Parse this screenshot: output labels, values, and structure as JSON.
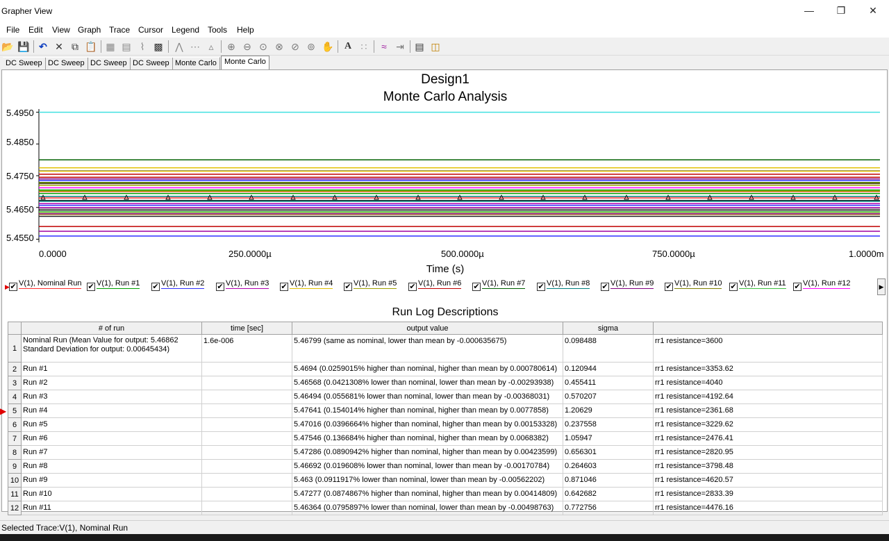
{
  "window": {
    "title": "Grapher View"
  },
  "menu": [
    "File",
    "Edit",
    "View",
    "Graph",
    "Trace",
    "Cursor",
    "Legend",
    "Tools",
    "Help"
  ],
  "toolbar_icons": [
    "open-icon",
    "save-icon",
    "undo-icon",
    "delete-icon",
    "copy-icon",
    "paste-icon",
    "grid-icon",
    "fine-grid-icon",
    "log-axes-icon",
    "reverse-colors-icon",
    "trace-line-icon",
    "trace-points-icon",
    "trace-markers-icon",
    "zoom-in-icon",
    "zoom-out-icon",
    "zoom-fit-icon",
    "zoom-x-icon",
    "zoom-y-icon",
    "zoom-full-icon",
    "pan-icon",
    "text-icon",
    "cursor-icon",
    "overlay-icon",
    "export-icon",
    "properties-icon",
    "print-icon"
  ],
  "tabs": [
    "DC Sweep",
    "DC Sweep",
    "DC Sweep",
    "DC Sweep",
    "Monte Carlo",
    "Monte Carlo"
  ],
  "graph": {
    "title": "Design1",
    "subtitle": "Monte Carlo Analysis",
    "xlabel": "Time (s)",
    "yticks": [
      "5.4950",
      "5.4850",
      "5.4750",
      "5.4650",
      "5.4550"
    ],
    "xticks": [
      "0.0000",
      "250.0000µ",
      "500.0000µ",
      "750.0000µ",
      "1.0000m"
    ]
  },
  "chart_data": {
    "type": "line",
    "xlabel": "Time (s)",
    "ylim": [
      5.454,
      5.496
    ],
    "xlim": [
      0,
      0.001
    ],
    "series": [
      {
        "name": "V(1), Nominal Run",
        "color": "#ff3030",
        "y": 5.46799
      },
      {
        "name": "V(1), Run #1",
        "color": "#00a000",
        "y": 5.4694
      },
      {
        "name": "V(1), Run #2",
        "color": "#3030ff",
        "y": 5.46568
      },
      {
        "name": "V(1), Run #3",
        "color": "#b000b0",
        "y": 5.46494
      },
      {
        "name": "V(1), Run #4",
        "color": "#e0c000",
        "y": 5.47641
      },
      {
        "name": "V(1), Run #5",
        "color": "#a0a000",
        "y": 5.47016
      },
      {
        "name": "V(1), Run #6",
        "color": "#c00000",
        "y": 5.47546
      },
      {
        "name": "V(1), Run #7",
        "color": "#006000",
        "y": 5.47286
      },
      {
        "name": "V(1), Run #8",
        "color": "#008080",
        "y": 5.46692
      },
      {
        "name": "V(1), Run #9",
        "color": "#800080",
        "y": 5.463
      },
      {
        "name": "V(1), Run #10",
        "color": "#808000",
        "y": 5.47277
      },
      {
        "name": "V(1), Run #11",
        "color": "#40c040",
        "y": 5.46364
      },
      {
        "name": "V(1), Run #12",
        "color": "#ff00ff",
        "y": 5.4712
      }
    ]
  },
  "runlog": {
    "title": "Run Log Descriptions",
    "headers": [
      "# of run",
      "time [sec]",
      "output value",
      "sigma",
      ""
    ],
    "rows": [
      {
        "num": "1",
        "run": "Nominal Run (Mean Value for output: 5.46862  Standard Deviation for output: 0.00645434)",
        "time": "1.6e-006",
        "output": "5.46799 (same as nominal, lower than mean by -0.000635675)",
        "sigma": "0.098488",
        "param": "rr1 resistance=3600"
      },
      {
        "num": "2",
        "run": "Run #1",
        "time": "",
        "output": "5.4694 (0.0259015% higher than nominal, higher than mean by 0.000780614)",
        "sigma": "0.120944",
        "param": "rr1 resistance=3353.62"
      },
      {
        "num": "3",
        "run": "Run #2",
        "time": "",
        "output": "5.46568 (0.0421308% lower than nominal, lower than mean by -0.00293938)",
        "sigma": "0.455411",
        "param": "rr1 resistance=4040"
      },
      {
        "num": "4",
        "run": "Run #3",
        "time": "",
        "output": "5.46494 (0.055681% lower than nominal, lower than mean by -0.00368031)",
        "sigma": "0.570207",
        "param": "rr1 resistance=4192.64"
      },
      {
        "num": "5",
        "run": "Run #4",
        "time": "",
        "output": "5.47641 (0.154014% higher than nominal, higher than mean by 0.0077858)",
        "sigma": "1.20629",
        "param": "rr1 resistance=2361.68"
      },
      {
        "num": "6",
        "run": "Run #5",
        "time": "",
        "output": "5.47016 (0.0396664% higher than nominal, higher than mean by 0.00153328)",
        "sigma": "0.237558",
        "param": "rr1 resistance=3229.62"
      },
      {
        "num": "7",
        "run": "Run #6",
        "time": "",
        "output": "5.47546 (0.136684% higher than nominal, higher than mean by 0.0068382)",
        "sigma": "1.05947",
        "param": "rr1 resistance=2476.41"
      },
      {
        "num": "8",
        "run": "Run #7",
        "time": "",
        "output": "5.47286 (0.0890942% higher than nominal, higher than mean by 0.00423599)",
        "sigma": "0.656301",
        "param": "rr1 resistance=2820.95"
      },
      {
        "num": "9",
        "run": "Run #8",
        "time": "",
        "output": "5.46692 (0.019608% lower than nominal, lower than mean by -0.00170784)",
        "sigma": "0.264603",
        "param": "rr1 resistance=3798.48"
      },
      {
        "num": "10",
        "run": "Run #9",
        "time": "",
        "output": "5.463 (0.0911917% lower than nominal, lower than mean by -0.00562202)",
        "sigma": "0.871046",
        "param": "rr1 resistance=4620.57"
      },
      {
        "num": "11",
        "run": "Run #10",
        "time": "",
        "output": "5.47277 (0.0874867% higher than nominal, higher than mean by 0.00414809)",
        "sigma": "0.642682",
        "param": "rr1 resistance=2833.39"
      },
      {
        "num": "12",
        "run": "Run #11",
        "time": "",
        "output": "5.46364 (0.0795897% lower than nominal, lower than mean by -0.00498763)",
        "sigma": "0.772756",
        "param": "rr1 resistance=4476.16"
      }
    ]
  },
  "status": "Selected Trace:V(1), Nominal Run"
}
